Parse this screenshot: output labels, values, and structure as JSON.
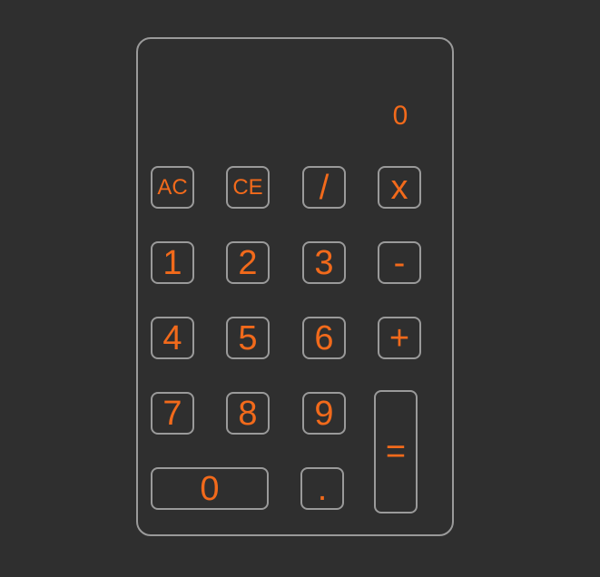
{
  "display": {
    "value": "0"
  },
  "keys": {
    "ac": "AC",
    "ce": "CE",
    "divide": "/",
    "multiply": "x",
    "one": "1",
    "two": "2",
    "three": "3",
    "minus": "-",
    "four": "4",
    "five": "5",
    "six": "6",
    "plus": "+",
    "seven": "7",
    "eight": "8",
    "nine": "9",
    "equals": "=",
    "zero": "0",
    "decimal": "."
  }
}
